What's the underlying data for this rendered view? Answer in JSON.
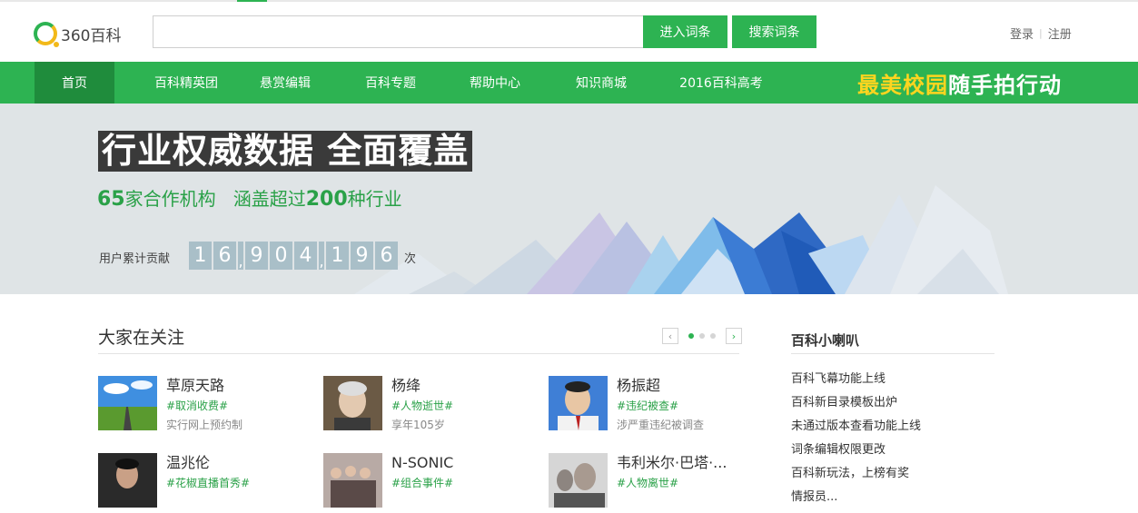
{
  "header": {
    "logo_text": "360百科",
    "search_placeholder": "",
    "enter_button": "进入词条",
    "search_button": "搜索词条",
    "login": "登录",
    "register": "注册"
  },
  "nav": {
    "items": [
      "首页",
      "百科精英团",
      "悬赏编辑",
      "百科专题",
      "帮助中心",
      "知识商城",
      "2016百科高考"
    ],
    "promo_yellow": "最美校园",
    "promo_white": "随手拍行动"
  },
  "banner": {
    "title": "行业权威数据 全面覆盖",
    "sub_num1": "65",
    "sub_text1": "家合作机构",
    "sub_text2": "涵盖超过",
    "sub_num2": "200",
    "sub_text3": "种行业",
    "counter_label": "用户累计贡献",
    "counter_digits": [
      "1",
      "6",
      ",",
      "9",
      "0",
      "4",
      ",",
      "1",
      "9",
      "6"
    ],
    "counter_unit": "次"
  },
  "main": {
    "section_title": "大家在关注",
    "cards": [
      {
        "name": "草原天路",
        "tag": "#取消收费#",
        "desc": "实行网上预约制"
      },
      {
        "name": "杨绛",
        "tag": "#人物逝世#",
        "desc": "享年105岁"
      },
      {
        "name": "杨振超",
        "tag": "#违纪被查#",
        "desc": "涉严重违纪被调查"
      },
      {
        "name": "温兆伦",
        "tag": "#花椒直播首秀#",
        "desc": ""
      },
      {
        "name": "N-SONIC",
        "tag": "#组合事件#",
        "desc": ""
      },
      {
        "name": "韦利米尔·巴塔·...",
        "tag": "#人物离世#",
        "desc": ""
      }
    ]
  },
  "sidebar": {
    "title": "百科小喇叭",
    "items": [
      "百科飞幕功能上线",
      "百科新目录模板出炉",
      "未通过版本查看功能上线",
      "词条编辑权限更改",
      "百科新玩法，上榜有奖",
      "情报员..."
    ]
  },
  "colors": {
    "brand_green": "#2db352",
    "nav_active": "#1f8c3c",
    "promo_yellow": "#ffd51f"
  }
}
